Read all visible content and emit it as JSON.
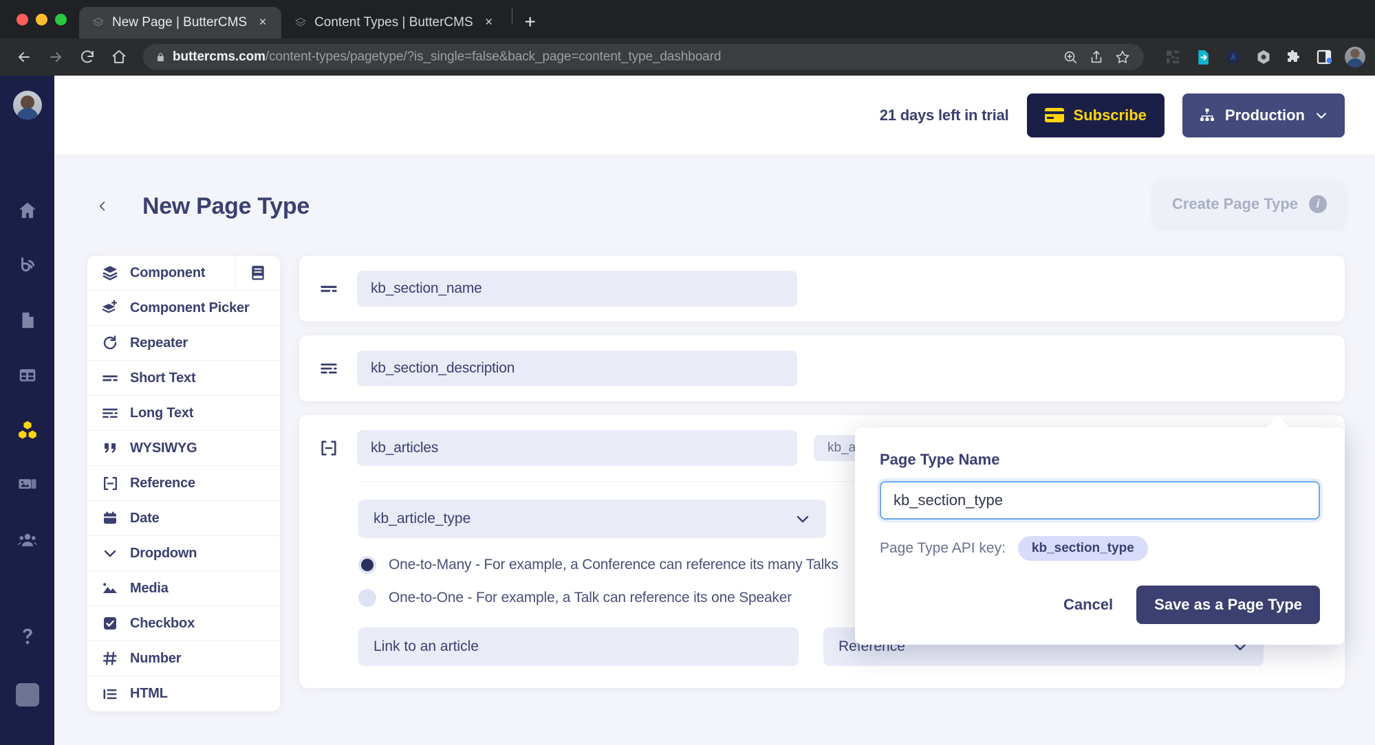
{
  "browser": {
    "tabs": [
      {
        "title": "New Page | ButterCMS",
        "active": true,
        "close": "×"
      },
      {
        "title": "Content Types | ButterCMS",
        "active": false,
        "close": "×"
      }
    ],
    "new_tab_label": "+",
    "url_domain": "buttercms.com",
    "url_path": "/content-types/pagetype/?is_single=false&back_page=content_type_dashboard"
  },
  "topbar": {
    "trial_text": "21 days left in trial",
    "subscribe_label": "Subscribe",
    "environment_label": "Production"
  },
  "page": {
    "title": "New Page Type",
    "create_button_label": "Create Page Type"
  },
  "palette": {
    "items": [
      {
        "label": "Component",
        "icon": "layers-icon"
      },
      {
        "label": "Component Picker",
        "icon": "layers-plus-icon"
      },
      {
        "label": "Repeater",
        "icon": "repeat-icon"
      },
      {
        "label": "Short Text",
        "icon": "short-text-icon"
      },
      {
        "label": "Long Text",
        "icon": "long-text-icon"
      },
      {
        "label": "WYSIWYG",
        "icon": "quote-icon"
      },
      {
        "label": "Reference",
        "icon": "reference-icon"
      },
      {
        "label": "Date",
        "icon": "calendar-icon"
      },
      {
        "label": "Dropdown",
        "icon": "chevron-down-icon"
      },
      {
        "label": "Media",
        "icon": "image-icon"
      },
      {
        "label": "Checkbox",
        "icon": "checkbox-icon"
      },
      {
        "label": "Number",
        "icon": "hash-icon"
      },
      {
        "label": "HTML",
        "icon": "list-icon"
      }
    ]
  },
  "fields": [
    {
      "name": "kb_section_name",
      "icon": "short-text-icon"
    },
    {
      "name": "kb_section_description",
      "icon": "long-text-icon"
    },
    {
      "name": "kb_articles",
      "icon": "reference-icon",
      "api_key": "kb_articles"
    }
  ],
  "reference_config": {
    "target_select_value": "kb_article_type",
    "relations": [
      {
        "label": "One-to-Many - For example, a Conference can reference its many Talks",
        "selected": true
      },
      {
        "label": "One-to-One - For example, a Talk can reference its one Speaker",
        "selected": false
      }
    ],
    "helper_text_value": "Link to an article",
    "field_type_value": "Reference"
  },
  "popover": {
    "label": "Page Type Name",
    "input_value": "kb_section_type",
    "api_key_label": "Page Type API key:",
    "api_key_value": "kb_section_type",
    "cancel_label": "Cancel",
    "save_label": "Save as a Page Type"
  },
  "colors": {
    "brand_navy": "#1b1f48",
    "accent_yellow": "#ffd60a",
    "app_bg": "#f4f5fa",
    "field_bg": "#e9ebf7",
    "danger_red": "#e04a3f"
  }
}
